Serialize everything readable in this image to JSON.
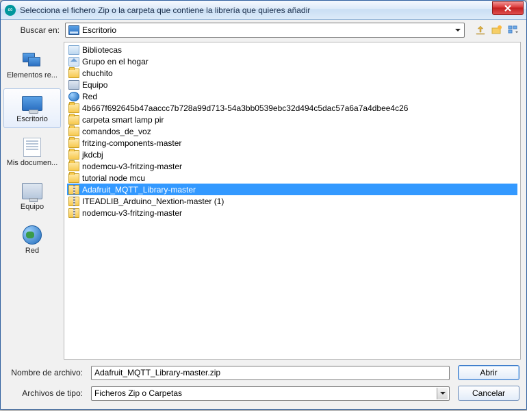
{
  "title": "Selecciona el fichero Zip o la carpeta que contiene la librería que quieres añadir",
  "lookInLabel": "Buscar en:",
  "lookInValue": "Escritorio",
  "places": [
    {
      "label": "Elementos re...",
      "kind": "recent"
    },
    {
      "label": "Escritorio",
      "kind": "monitor",
      "selected": true
    },
    {
      "label": "Mis documen...",
      "kind": "docs"
    },
    {
      "label": "Equipo",
      "kind": "pc"
    },
    {
      "label": "Red",
      "kind": "globe"
    }
  ],
  "items": [
    {
      "label": "Bibliotecas",
      "icon": "lib"
    },
    {
      "label": "Grupo en el hogar",
      "icon": "home"
    },
    {
      "label": "chuchito",
      "icon": "folder"
    },
    {
      "label": "Equipo",
      "icon": "pc"
    },
    {
      "label": "Red",
      "icon": "net"
    },
    {
      "label": "4b667f692645b47aaccc7b728a99d713-54a3bb0539ebc32d494c5dac57a6a7a4dbee4c26",
      "icon": "folder"
    },
    {
      "label": "carpeta smart lamp pir",
      "icon": "folder"
    },
    {
      "label": "comandos_de_voz",
      "icon": "folder"
    },
    {
      "label": "fritzing-components-master",
      "icon": "folder"
    },
    {
      "label": "jkdcbj",
      "icon": "folder"
    },
    {
      "label": "nodemcu-v3-fritzing-master",
      "icon": "folder"
    },
    {
      "label": "tutorial node mcu",
      "icon": "folder"
    },
    {
      "label": "Adafruit_MQTT_Library-master",
      "icon": "zip",
      "selected": true
    },
    {
      "label": "ITEADLIB_Arduino_Nextion-master (1)",
      "icon": "zip"
    },
    {
      "label": "nodemcu-v3-fritzing-master",
      "icon": "zip"
    }
  ],
  "filenameLabel": "Nombre de archivo:",
  "filenameValue": "Adafruit_MQTT_Library-master.zip",
  "filetypeLabel": "Archivos de tipo:",
  "filetypeValue": "Ficheros Zip o Carpetas",
  "openLabel": "Abrir",
  "cancelLabel": "Cancelar"
}
